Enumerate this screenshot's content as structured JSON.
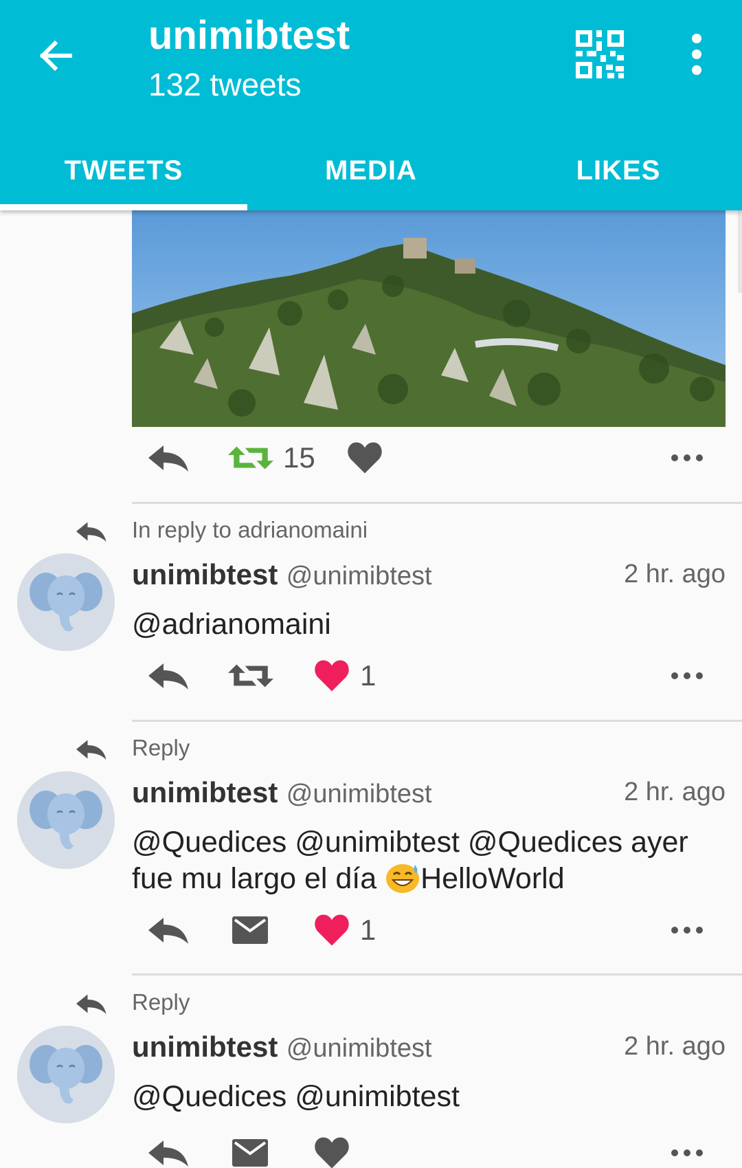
{
  "header": {
    "title": "unimibtest",
    "subtitle": "132 tweets",
    "accent_color": "#00bcd4",
    "icons": [
      "back-arrow-icon",
      "qr-code-icon",
      "more-vert-icon"
    ]
  },
  "tabs": [
    {
      "label": "TWEETS",
      "active": true
    },
    {
      "label": "MEDIA",
      "active": false
    },
    {
      "label": "LIKES",
      "active": false
    }
  ],
  "tweets": [
    {
      "media": true,
      "actions": {
        "retweet_count": "15",
        "retweeted": true,
        "liked": false,
        "like_count": ""
      }
    },
    {
      "context": "In reply to adrianomaini",
      "name": "unimibtest",
      "handle": "@unimibtest",
      "time": "2 hr. ago",
      "text": "@adrianomaini",
      "actions": {
        "second_action": "retweet",
        "liked": true,
        "like_count": "1"
      }
    },
    {
      "context": "Reply",
      "name": "unimibtest",
      "handle": "@unimibtest",
      "time": "2 hr. ago",
      "text_line1": "@Quedices @unimibtest @Quedices  ayer",
      "text_line2_a": "fue mu largo el día ",
      "emoji": "grinning-sweat-emoji",
      "text_line2_b": "HelloWorld",
      "actions": {
        "second_action": "direct-message",
        "liked": true,
        "like_count": "1"
      }
    },
    {
      "context": "Reply",
      "name": "unimibtest",
      "handle": "@unimibtest",
      "time": "2 hr. ago",
      "text": "@Quedices @unimibtest",
      "actions": {
        "second_action": "direct-message",
        "liked": false,
        "like_count": ""
      }
    }
  ],
  "colors": {
    "like": "#ee1f5c",
    "retweet_active": "#5bb33e",
    "icon_gray": "#555555"
  }
}
